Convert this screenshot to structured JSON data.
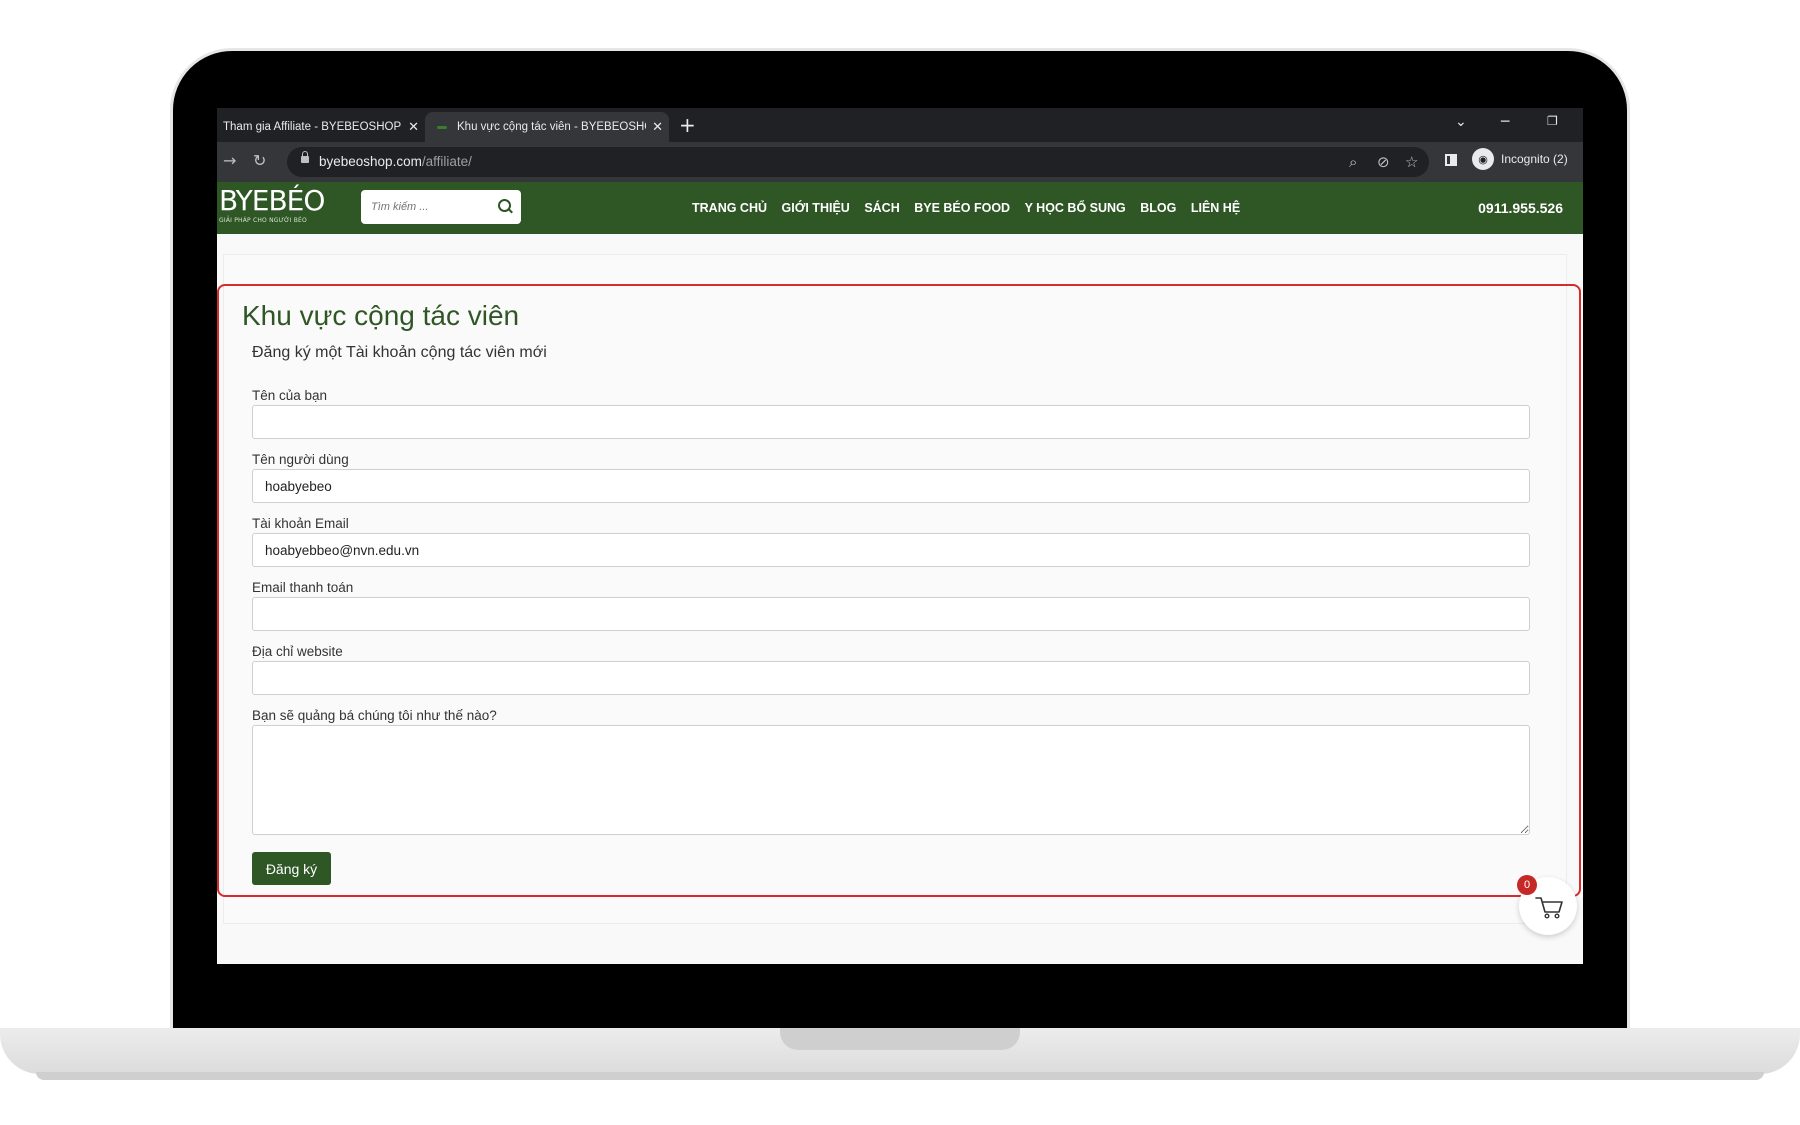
{
  "browser": {
    "tabs": [
      {
        "title": "Tham gia Affiliate - BYEBEOSHOP",
        "active": false
      },
      {
        "title": "Khu vực cộng tác viên - BYEBEOSHOP",
        "active": true
      }
    ],
    "new_tab": "+",
    "url_host": "byebeoshop.com",
    "url_path": "/affiliate/",
    "incognito_label": "Incognito (2)",
    "window_controls": [
      "chevron-down",
      "minimize",
      "restore"
    ]
  },
  "site": {
    "logo_text": "BYEBÉO",
    "logo_tagline": "GIẢI PHÁP CHO NGƯỜI BÉO",
    "search_placeholder": "Tìm kiếm ...",
    "menu": [
      "TRANG CHỦ",
      "GIỚI THIỆU",
      "SÁCH",
      "BYE BÉO FOOD",
      "Y HỌC BỔ SUNG",
      "BLOG",
      "LIÊN HỆ"
    ],
    "phone": "0911.955.526",
    "brand_color": "#2f5726"
  },
  "form": {
    "title": "Khu vực cộng tác viên",
    "subtitle": "Đăng ký một Tài khoản cộng tác viên mới",
    "fields": [
      {
        "label": "Tên của bạn",
        "value": ""
      },
      {
        "label": "Tên người dùng",
        "value": "hoabyebeo"
      },
      {
        "label": "Tài khoản Email",
        "value": "hoabyebbeo@nvn.edu.vn"
      },
      {
        "label": "Email thanh toán",
        "value": ""
      },
      {
        "label": "Địa chỉ website",
        "value": ""
      }
    ],
    "textarea_label": "Bạn sẽ quảng bá chúng tôi như thế nào?",
    "submit_label": "Đăng ký"
  },
  "cart": {
    "count": "0"
  }
}
